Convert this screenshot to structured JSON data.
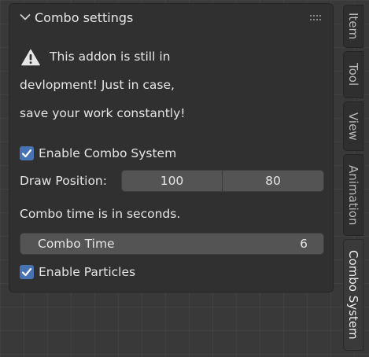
{
  "panel": {
    "title": "Combo settings",
    "message_lines": [
      "This addon is still in",
      "devlopment! Just in case,",
      "save your work constantly!"
    ],
    "enable_combo": {
      "label": "Enable Combo System",
      "checked": true
    },
    "draw_position": {
      "label": "Draw Position:",
      "x": "100",
      "y": "80"
    },
    "combo_time_note": "Combo time is in seconds.",
    "combo_time": {
      "label": "Combo Time",
      "value": "6"
    },
    "enable_particles": {
      "label": "Enable Particles",
      "checked": true
    }
  },
  "sidebar_tabs": [
    {
      "label": "Item",
      "active": false
    },
    {
      "label": "Tool",
      "active": false
    },
    {
      "label": "View",
      "active": false
    },
    {
      "label": "Animation",
      "active": false
    },
    {
      "label": "Combo System",
      "active": true
    }
  ],
  "colors": {
    "accent": "#4772b3",
    "panel_bg": "#303030",
    "field_bg": "#545454",
    "viewport_bg": "#393939"
  }
}
